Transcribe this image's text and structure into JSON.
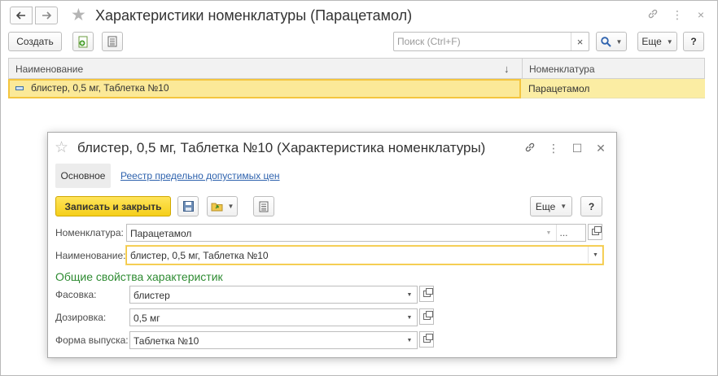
{
  "window": {
    "title": "Характеристики номенклатуры (Парацетамол)",
    "back_icon": "arrow-left-icon",
    "forward_icon": "arrow-right-icon"
  },
  "toolbar": {
    "create_label": "Создать",
    "search_placeholder": "Поиск (Ctrl+F)",
    "search_clear": "×",
    "more_label": "Еще",
    "help_label": "?"
  },
  "list": {
    "columns": [
      "Наименование",
      "Номенклатура"
    ],
    "sort_indicator": "↓",
    "rows": [
      {
        "name": "блистер, 0,5 мг, Таблетка №10",
        "nomenclature": "Парацетамол"
      }
    ]
  },
  "dialog": {
    "title": "блистер, 0,5 мг, Таблетка №10 (Характеристика номенклатуры)",
    "tabs": [
      "Основное",
      "Реестр предельно допустимых цен"
    ],
    "save_close_label": "Записать и закрыть",
    "more_label": "Еще",
    "help_label": "?",
    "fields": {
      "nomenclature": {
        "label": "Номенклатура:",
        "value": "Парацетамол"
      },
      "name": {
        "label": "Наименование:",
        "value": "блистер, 0,5 мг, Таблетка №10"
      }
    },
    "section_title": "Общие свойства характеристик",
    "properties": [
      {
        "label": "Фасовка:",
        "value": "блистер"
      },
      {
        "label": "Дозировка:",
        "value": "0,5 мг"
      },
      {
        "label": "Форма выпуска:",
        "value": "Таблетка №10"
      }
    ]
  },
  "colors": {
    "accent_yellow": "#f5cf1a",
    "selection_row": "#fbeda3",
    "section_green": "#2e8b32",
    "link_blue": "#2f63ae"
  }
}
